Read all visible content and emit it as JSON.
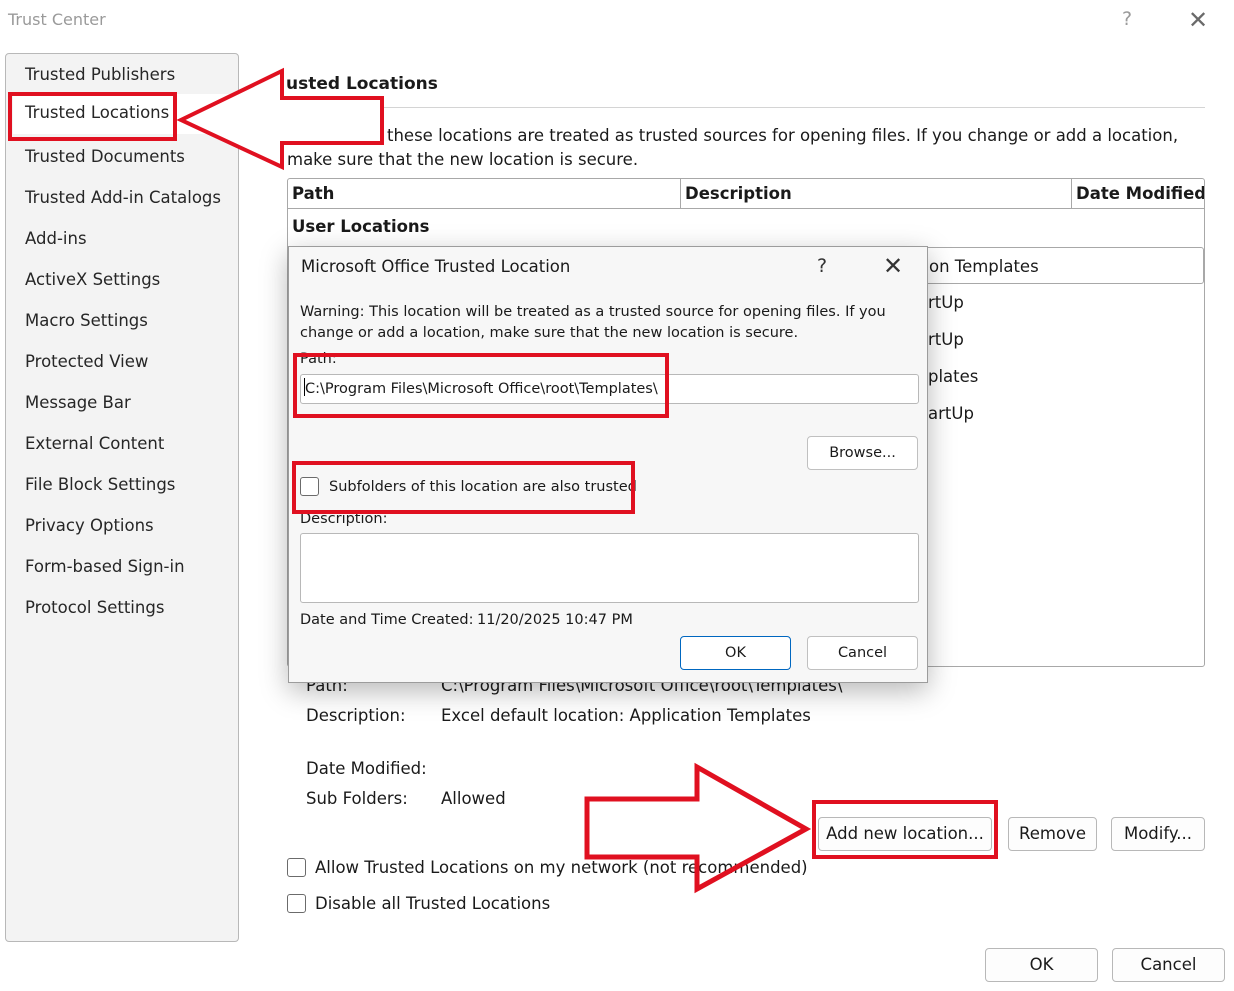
{
  "window": {
    "title": "Trust Center",
    "help_glyph": "?",
    "close_glyph": "✕"
  },
  "sidebar": {
    "items": [
      {
        "label": "Trusted Publishers"
      },
      {
        "label": "Trusted Locations",
        "selected": true
      },
      {
        "label": "Trusted Documents"
      },
      {
        "label": "Trusted Add-in Catalogs"
      },
      {
        "label": "Add-ins"
      },
      {
        "label": "ActiveX Settings"
      },
      {
        "label": "Macro Settings"
      },
      {
        "label": "Protected View"
      },
      {
        "label": "Message Bar"
      },
      {
        "label": "External Content"
      },
      {
        "label": "File Block Settings"
      },
      {
        "label": "Privacy Options"
      },
      {
        "label": "Form-based Sign-in"
      },
      {
        "label": "Protocol Settings"
      }
    ]
  },
  "main": {
    "heading": "usted Locations",
    "intro": "these locations are treated as trusted sources for opening files.  If you change or add a location, make sure that the new location is secure.",
    "table": {
      "columns": [
        "Path",
        "Description",
        "Date Modified"
      ],
      "group_label": "User Locations",
      "rows": [
        {
          "description": "on Templates",
          "selected": true
        },
        {
          "description": "rtUp"
        },
        {
          "description": "rtUp"
        },
        {
          "description": "plates"
        },
        {
          "description": "artUp"
        }
      ]
    },
    "details": {
      "path_label": "Path:",
      "path_value": "C:\\Program Files\\Microsoft Office\\root\\Templates\\",
      "description_label": "Description:",
      "description_value": "Excel default location: Application Templates",
      "date_modified_label": "Date Modified:",
      "date_modified_value": "",
      "sub_folders_label": "Sub Folders:",
      "sub_folders_value": "Allowed"
    },
    "buttons": {
      "add_new_location": "Add new location...",
      "remove": "Remove",
      "modify": "Modify..."
    },
    "checkboxes": {
      "allow_network": {
        "label": "Allow Trusted Locations on my network (not recommended)",
        "checked": false
      },
      "disable_all": {
        "label": "Disable all Trusted Locations",
        "checked": false
      }
    }
  },
  "footer": {
    "ok": "OK",
    "cancel": "Cancel"
  },
  "dialog": {
    "title": "Microsoft Office Trusted Location",
    "help_glyph": "?",
    "close_glyph": "✕",
    "warning": "Warning: This location will be treated as a trusted source for opening files. If you change or add a location, make sure that the new location is secure.",
    "path_label": "Path:",
    "path_value": "C:\\Program Files\\Microsoft Office\\root\\Templates\\",
    "browse_button": "Browse...",
    "subfolders_label": "Subfolders of this location are also trusted",
    "subfolders_checked": false,
    "description_label": "Description:",
    "description_value": "",
    "date_created_label": "Date and Time Created:",
    "date_created_value": "11/20/2025 10:47 PM",
    "ok": "OK",
    "cancel": "Cancel"
  },
  "colors": {
    "annotation_red": "#e01020",
    "primary_button_border": "#0067c0",
    "sidebar_bg": "#f3f3f3"
  }
}
